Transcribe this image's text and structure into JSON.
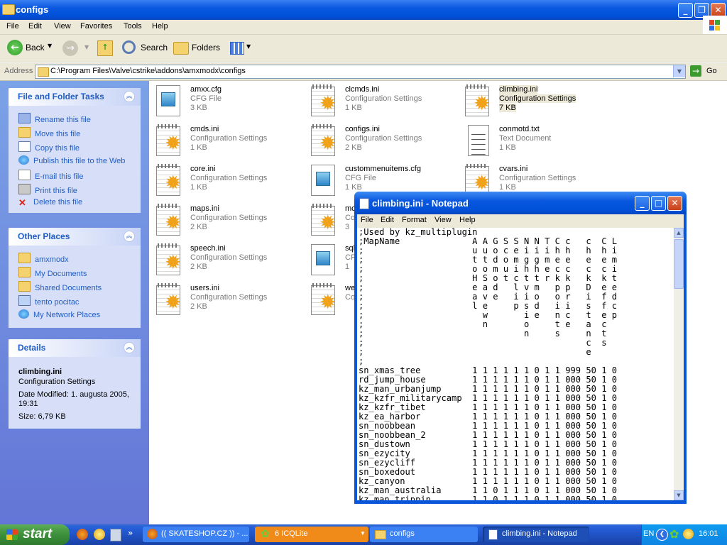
{
  "window": {
    "title": "configs"
  },
  "menu": [
    "File",
    "Edit",
    "View",
    "Favorites",
    "Tools",
    "Help"
  ],
  "toolbar": {
    "back": "Back",
    "search": "Search",
    "folders": "Folders"
  },
  "address": {
    "label": "Address",
    "path": "C:\\Program Files\\Valve\\cstrike\\addons\\amxmodx\\configs",
    "go": "Go"
  },
  "tasks": {
    "title": "File and Folder Tasks",
    "items": [
      "Rename this file",
      "Move this file",
      "Copy this file",
      "Publish this file to the Web",
      "E-mail this file",
      "Print this file",
      "Delete this file"
    ]
  },
  "places": {
    "title": "Other Places",
    "items": [
      "amxmodx",
      "My Documents",
      "Shared Documents",
      "tento pocitac",
      "My Network Places"
    ]
  },
  "details": {
    "title": "Details",
    "name": "climbing.ini",
    "type": "Configuration Settings",
    "modified": "Date Modified: 1. augusta 2005, 19:31",
    "size": "Size: 6,79 KB"
  },
  "files": [
    {
      "name": "amxx.cfg",
      "type": "CFG File",
      "size": "3 KB",
      "icon": "cfg"
    },
    {
      "name": "clcmds.ini",
      "type": "Configuration Settings",
      "size": "1 KB",
      "icon": "ini"
    },
    {
      "name": "climbing.ini",
      "type": "Configuration Settings",
      "size": "7 KB",
      "icon": "ini"
    },
    {
      "name": "cmds.ini",
      "type": "Configuration Settings",
      "size": "1 KB",
      "icon": "ini"
    },
    {
      "name": "configs.ini",
      "type": "Configuration Settings",
      "size": "2 KB",
      "icon": "ini"
    },
    {
      "name": "conmotd.txt",
      "type": "Text Document",
      "size": "1 KB",
      "icon": "txt"
    },
    {
      "name": "core.ini",
      "type": "Configuration Settings",
      "size": "1 KB",
      "icon": "ini"
    },
    {
      "name": "custommenuitems.cfg",
      "type": "CFG File",
      "size": "1 KB",
      "icon": "cfg"
    },
    {
      "name": "cvars.ini",
      "type": "Configuration Settings",
      "size": "1 KB",
      "icon": "ini"
    },
    {
      "name": "maps.ini",
      "type": "Configuration Settings",
      "size": "2 KB",
      "icon": "ini"
    },
    {
      "name": "mo",
      "type": "Co",
      "size": "3",
      "icon": "ini"
    },
    {
      "name": "",
      "type": "",
      "size": "",
      "icon": "none"
    },
    {
      "name": "speech.ini",
      "type": "Configuration Settings",
      "size": "2 KB",
      "icon": "ini"
    },
    {
      "name": "sql",
      "type": "CF",
      "size": "1",
      "icon": "cfg"
    },
    {
      "name": "",
      "type": "",
      "size": "",
      "icon": "none"
    },
    {
      "name": "users.ini",
      "type": "Configuration Settings",
      "size": "2 KB",
      "icon": "ini"
    },
    {
      "name": "we",
      "type": "Co",
      "size": "",
      "icon": "ini"
    }
  ],
  "notepad": {
    "title": "climbing.ini - Notepad",
    "menu": [
      "File",
      "Edit",
      "Format",
      "View",
      "Help"
    ],
    "text": ";Used by kz_multiplugin\n;MapName              A A G S S N N T C c   c  C L\n;                     u u o c e i i i h h   h  h i\n;                     t t d o m g g m e e   e  e m\n;                     o o m u i h h e c c   c  c i\n;                     H S o t c t t r k k   k  k t\n;                     e a d   l v m   p p   D  e e\n;                     a v e   i i o   o r   i  f d\n;                     l e     p s d   i i   s  f c\n;                       w       i e   n c   t  e p\n;                       n       o     t e   a  c\n;                               n     s     n  t\n;                                           c  s\n;                                           e\n;\nsn_xmas_tree          1 1 1 1 1 1 0 1 1 999 50 1 0\nrd_jump_house         1 1 1 1 1 1 0 1 1 000 50 1 0\nkz_man_urbanjump      1 1 1 1 1 1 0 1 1 000 50 1 0\nkz_kzfr_militarycamp  1 1 1 1 1 1 0 1 1 000 50 1 0\nkz_kzfr_tibet         1 1 1 1 1 1 0 1 1 000 50 1 0\nkz_ea_harbor          1 1 1 1 1 1 0 1 1 000 50 1 0\nsn_noobbean           1 1 1 1 1 1 0 1 1 000 50 1 0\nsn_noobbean_2         1 1 1 1 1 1 0 1 1 000 50 1 0\nsn_dustown            1 1 1 1 1 1 0 1 1 000 50 1 0\nsn_ezycity            1 1 1 1 1 1 0 1 1 000 50 1 0\nsn_ezycliff           1 1 1 1 1 1 0 1 1 000 50 1 0\nsn_boxedout           1 1 1 1 1 1 0 1 1 000 50 1 0\nkz_canyon             1 1 1 1 1 1 0 1 1 000 50 1 0\nkz_man_australia      1 1 0 1 1 1 0 1 1 000 50 1 0\nkz_man_trippin        1 1 0 1 1 1 0 1 1 000 50 1 0"
  },
  "taskbar": {
    "start": "start",
    "tasks": [
      "(( SKATESHOP.CZ )) - ...",
      "6 ICQLite",
      "configs",
      "climbing.ini - Notepad"
    ],
    "lang": "EN",
    "time": "16:01"
  },
  "colors": {
    "xpBlue": "#0a58e0",
    "taskPane": "#6375d6",
    "linkBlue": "#215dc6"
  }
}
